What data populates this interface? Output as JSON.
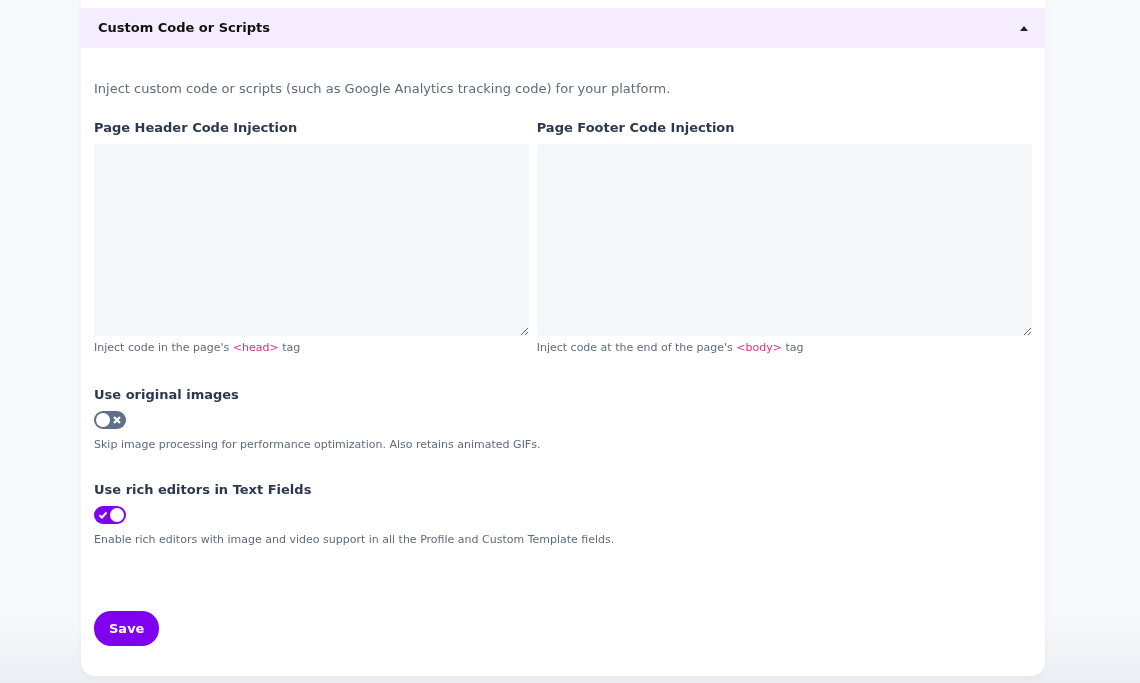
{
  "section": {
    "title": "Custom Code or Scripts",
    "expanded": true,
    "description": "Inject custom code or scripts (such as Google Analytics tracking code) for your platform.",
    "code_fields": [
      {
        "label": "Page Header Code Injection",
        "help_before": "Inject code in the page's ",
        "help_code": "<head>",
        "help_after": " tag"
      },
      {
        "label": "Page Footer Code Injection",
        "help_before": "Inject code at the end of the page's ",
        "help_code": "<body>",
        "help_after": " tag"
      }
    ],
    "toggles": [
      {
        "label": "Use original images",
        "on": false,
        "help": "Skip image processing for performance optimization. Also retains animated GIFs."
      },
      {
        "label": "Use rich editors in Text Fields",
        "on": true,
        "help": "Enable rich editors with image and video support in all the Profile and Custom Template fields."
      }
    ],
    "save_button": "Save"
  }
}
